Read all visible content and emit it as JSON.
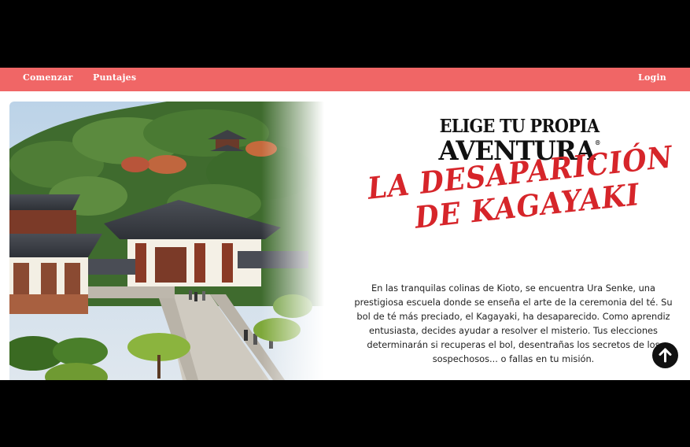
{
  "nav": {
    "items": [
      "Comenzar",
      "Puntajes"
    ],
    "login": "Login"
  },
  "hero": {
    "image": "kyoto-temple-hillside",
    "title_line1": "ELIGE TU PROPIA",
    "title_line2": "AVENTURA",
    "title_mark": "®",
    "subtitle_line1": "LA DESAPARICIÓN",
    "subtitle_line2": "DE KAGAYAKI",
    "intro": "En las tranquilas colinas de Kioto, se encuentra Ura Senke, una prestigiosa escuela donde se enseña el arte de la ceremonia del té. Su bol de té más preciado, el Kagayaki, ha desaparecido. Como aprendiz entusiasta, decides ayudar a resolver el misterio. Tus elecciones determinarán si recuperas el bol, desentrañas los secretos de los sospechosos... o fallas en tu misión."
  },
  "scroll_button": {
    "icon": "arrow-up-icon"
  },
  "colors": {
    "nav_bg": "#f06666",
    "title_red": "#d6252a",
    "title_black": "#111111"
  }
}
